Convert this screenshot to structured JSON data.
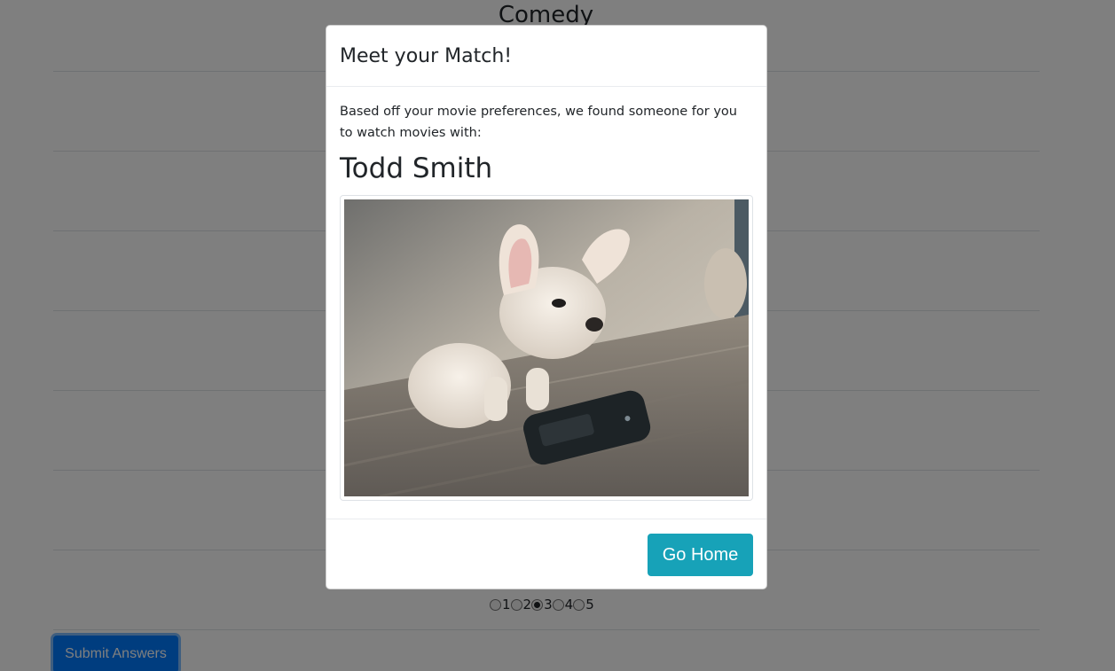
{
  "survey": {
    "category_title": "Comedy",
    "rating_options": [
      "1",
      "2",
      "3",
      "4",
      "5"
    ],
    "selected_rating": "3",
    "submit_label": "Submit Answers"
  },
  "modal": {
    "title": "Meet your Match!",
    "message": "Based off your movie preferences, we found someone for you to watch movies with:",
    "match_name": "Todd Smith",
    "photo_icon": "french-bulldog-puppy-photo",
    "go_home_label": "Go Home"
  },
  "colors": {
    "primary": "#007bff",
    "info": "#17a2b8",
    "backdrop": "rgba(0,0,0,0.5)"
  }
}
